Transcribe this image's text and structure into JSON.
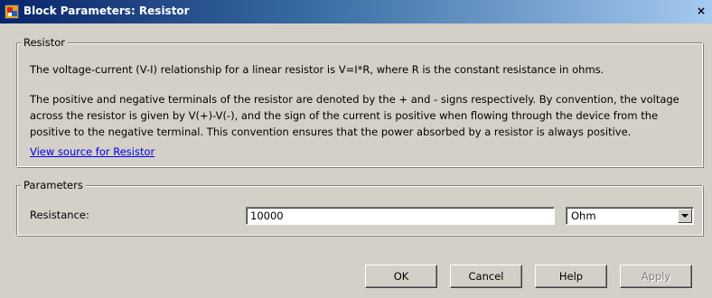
{
  "window": {
    "title": "Block Parameters: Resistor",
    "close_glyph": "×",
    "icon": "simulink-block-icon"
  },
  "description_group": {
    "legend": "Resistor",
    "paragraph1": "The voltage-current (V-I) relationship for a linear resistor is V=I*R, where R is the constant resistance in ohms.",
    "paragraph2_lines": [
      "The positive and negative terminals of the resistor are denoted by the + and - signs respectively. By convention, the voltage",
      "across the resistor is given by V(+)-V(-), and the sign of the current is positive when flowing through the device from the",
      "positive to the negative terminal. This convention ensures that the power absorbed by a resistor is always positive."
    ],
    "link": "View source for Resistor"
  },
  "parameters_group": {
    "legend": "Parameters",
    "resistance_label": "Resistance:",
    "resistance_value": "10000",
    "unit_value": "Ohm"
  },
  "buttons": {
    "ok": "OK",
    "cancel": "Cancel",
    "help": "Help",
    "apply": "Apply"
  },
  "colors": {
    "dialog_bg": "#d4d0c8",
    "title_gradient_start": "#0a246a",
    "title_gradient_end": "#a6caf0",
    "link": "#0000ee"
  }
}
